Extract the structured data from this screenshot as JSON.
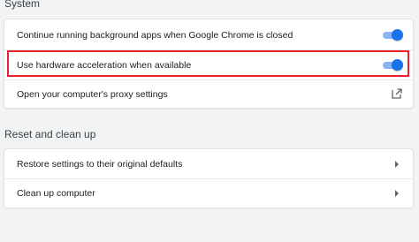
{
  "system": {
    "title": "System",
    "items": [
      {
        "label": "Continue running background apps when Google Chrome is closed",
        "toggle_on": true,
        "control": "toggle"
      },
      {
        "label": "Use hardware acceleration when available",
        "toggle_on": true,
        "control": "toggle",
        "highlighted": true
      },
      {
        "label": "Open your computer's proxy settings",
        "control": "external-link-icon"
      }
    ]
  },
  "reset": {
    "title": "Reset and clean up",
    "items": [
      {
        "label": "Restore settings to their original defaults",
        "control": "arrow-right-icon"
      },
      {
        "label": "Clean up computer",
        "control": "arrow-right-icon"
      }
    ]
  },
  "colors": {
    "toggle_knob": "#1a73e8",
    "toggle_track": "#8ab4f8",
    "highlight_border": "#e8212b",
    "page_background": "#f1f3f4"
  }
}
